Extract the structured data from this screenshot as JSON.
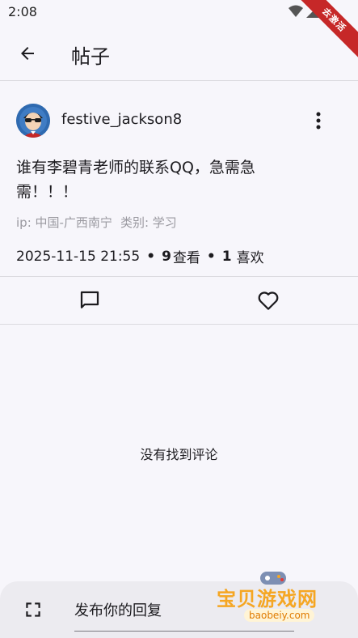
{
  "status_bar": {
    "time": "2:08",
    "ribbon": "去激活"
  },
  "app_bar": {
    "title": "帖子"
  },
  "post": {
    "username": "festive_jackson8",
    "body": "谁有李碧青老师的联系QQ，急需急需！！！",
    "ip": "ip: 中国-广西南宁",
    "category": "类别: 学习",
    "date": "2025-11-15 21:55",
    "views_count": "9",
    "views_label": "查看",
    "likes_count": "1",
    "likes_label": "喜欢"
  },
  "comments": {
    "empty_text": "没有找到评论"
  },
  "reply": {
    "placeholder": "发布你的回复"
  },
  "watermark": {
    "text": "宝贝游戏网",
    "url": "baobeiy.com"
  }
}
